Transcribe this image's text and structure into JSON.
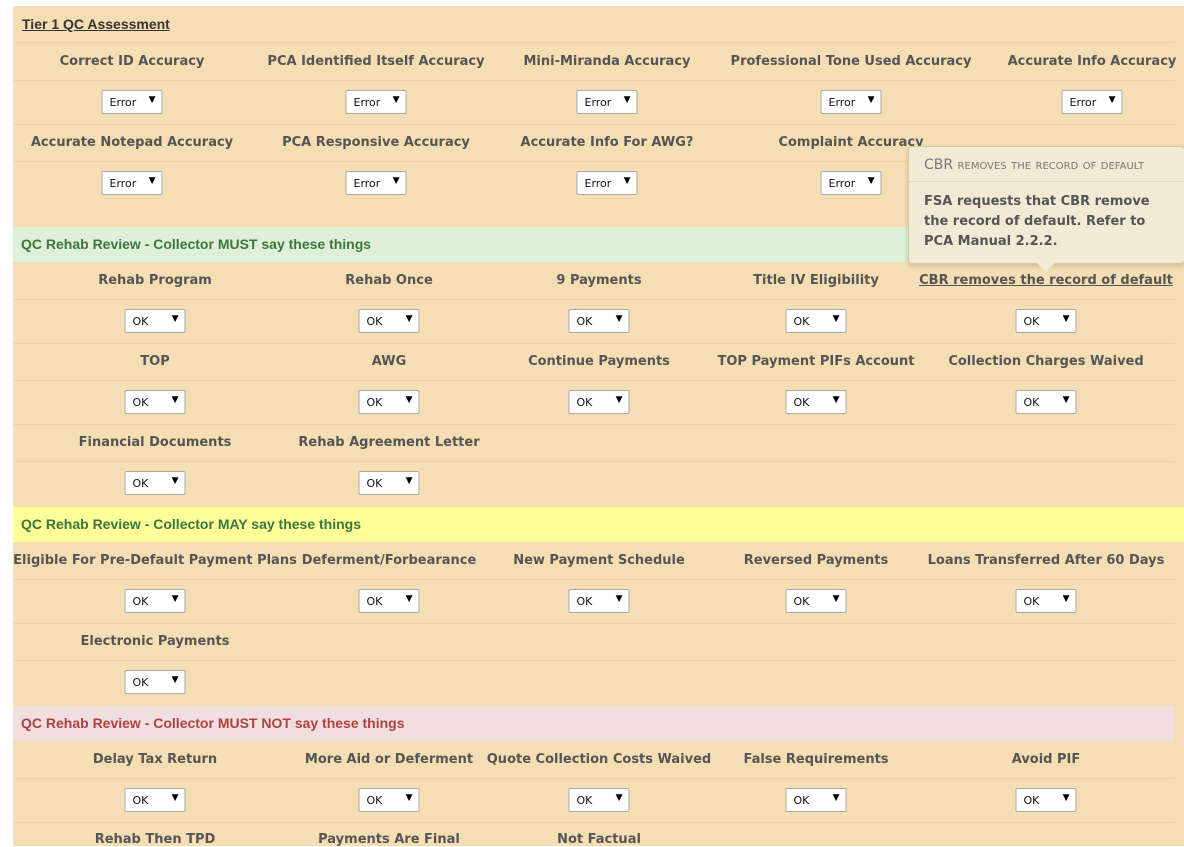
{
  "tier1": {
    "title": "Tier 1 QC Assessment",
    "row1": [
      {
        "label": "Correct ID Accuracy",
        "value": "Error"
      },
      {
        "label": "PCA Identified Itself Accuracy",
        "value": "Error"
      },
      {
        "label": "Mini-Miranda Accuracy",
        "value": "Error"
      },
      {
        "label": "Professional Tone Used Accuracy",
        "value": "Error"
      },
      {
        "label": "Accurate Info Accuracy",
        "value": "Error"
      }
    ],
    "row2": [
      {
        "label": "Accurate Notepad Accuracy",
        "value": "Error"
      },
      {
        "label": "PCA Responsive Accuracy",
        "value": "Error"
      },
      {
        "label": "Accurate Info For AWG?",
        "value": "Error"
      },
      {
        "label": "Complaint Accuracy",
        "value": "Error"
      }
    ]
  },
  "must": {
    "header": "QC Rehab Review - Collector MUST say these things",
    "row1": [
      {
        "label": "Rehab Program",
        "value": "OK"
      },
      {
        "label": "Rehab Once",
        "value": "OK"
      },
      {
        "label": "9 Payments",
        "value": "OK"
      },
      {
        "label": "Title IV Eligibility",
        "value": "OK"
      },
      {
        "label": "CBR removes the record of default",
        "value": "OK"
      }
    ],
    "row2": [
      {
        "label": "TOP",
        "value": "OK"
      },
      {
        "label": "AWG",
        "value": "OK"
      },
      {
        "label": "Continue Payments",
        "value": "OK"
      },
      {
        "label": "TOP Payment PIFs Account",
        "value": "OK"
      },
      {
        "label": "Collection Charges Waived",
        "value": "OK"
      }
    ],
    "row3": [
      {
        "label": "Financial Documents",
        "value": "OK"
      },
      {
        "label": "Rehab Agreement Letter",
        "value": "OK"
      }
    ]
  },
  "may": {
    "header": "QC Rehab Review - Collector MAY say these things",
    "row1": [
      {
        "label": "Eligible For Pre-Default Payment Plans",
        "value": "OK"
      },
      {
        "label": "Deferment/Forbearance",
        "value": "OK"
      },
      {
        "label": "New Payment Schedule",
        "value": "OK"
      },
      {
        "label": "Reversed Payments",
        "value": "OK"
      },
      {
        "label": "Loans Transferred After 60 Days",
        "value": "OK"
      }
    ],
    "row2": [
      {
        "label": "Electronic Payments",
        "value": "OK"
      }
    ]
  },
  "mustnot": {
    "header": "QC Rehab Review - Collector MUST NOT say these things",
    "row1": [
      {
        "label": "Delay Tax Return",
        "value": "OK"
      },
      {
        "label": "More Aid or Deferment",
        "value": "OK"
      },
      {
        "label": "Quote Collection Costs Waived",
        "value": "OK"
      },
      {
        "label": "False Requirements",
        "value": "OK"
      },
      {
        "label": "Avoid PIF",
        "value": "OK"
      }
    ],
    "row2": [
      {
        "label": "Rehab Then TPD"
      },
      {
        "label": "Payments Are Final"
      },
      {
        "label": "Not Factual"
      }
    ]
  },
  "popover": {
    "title": "CBR removes the record of default",
    "body": "FSA requests that CBR remove the record of default. Refer to PCA Manual 2.2.2."
  },
  "icons": {
    "dropdown": "caret-down-icon"
  },
  "colors": {
    "panel": "#f5deb3",
    "must": "#dff0d8",
    "may": "#ffff99",
    "mustnot": "#f2dede"
  }
}
